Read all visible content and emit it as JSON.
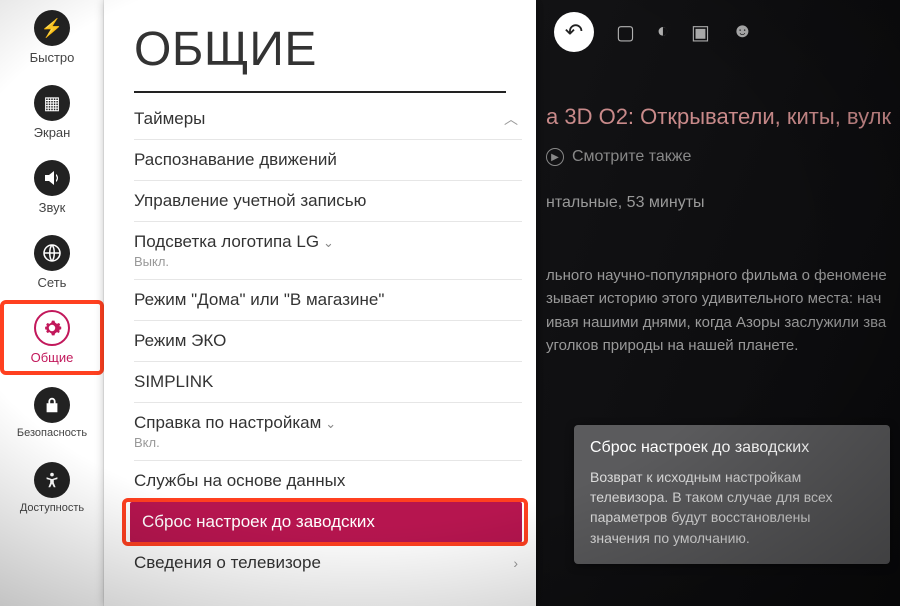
{
  "sidebar": {
    "items": [
      {
        "label": "Быстро",
        "icon": "bolt"
      },
      {
        "label": "Экран",
        "icon": "screen"
      },
      {
        "label": "Звук",
        "icon": "sound"
      },
      {
        "label": "Сеть",
        "icon": "globe"
      },
      {
        "label": "Общие",
        "icon": "gear",
        "selected": true
      },
      {
        "label": "Безопасность",
        "icon": "lock"
      },
      {
        "label": "Доступность",
        "icon": "accessibility"
      }
    ]
  },
  "panel": {
    "title": "ОБЩИЕ",
    "items": [
      {
        "label": "Таймеры",
        "scroll_up": true
      },
      {
        "label": "Распознавание движений"
      },
      {
        "label": "Управление учетной записью"
      },
      {
        "label": "Подсветка логотипа LG",
        "sub": "Выкл.",
        "caret": "down"
      },
      {
        "label": "Режим \"Дома\" или \"В магазине\""
      },
      {
        "label": "Режим ЭКО"
      },
      {
        "label": "SIMPLINK"
      },
      {
        "label": "Справка по настройкам",
        "sub": "Вкл.",
        "caret": "down"
      },
      {
        "label": "Службы на основе данных"
      },
      {
        "label": "Сброс настроек до заводских",
        "highlight": true
      },
      {
        "label": "Сведения о телевизоре",
        "chevron": true
      }
    ]
  },
  "background": {
    "program_title": "а 3D O2: Открыватели, киты, вулк",
    "see_also": "Смотрите также",
    "meta": "нтальные, 53 минуты",
    "description_lines": [
      "льного научно-популярного фильма о феномене",
      "зывает историю этого удивительного места: нач",
      "ивая нашими днями, когда Азоры заслужили зва",
      "уголков природы на нашей планете."
    ]
  },
  "tooltip": {
    "title": "Сброс настроек до заводских",
    "body": "Возврат к исходным настройкам телевизора. В таком случае для всех параметров будут восстановлены значения по умолчанию."
  }
}
